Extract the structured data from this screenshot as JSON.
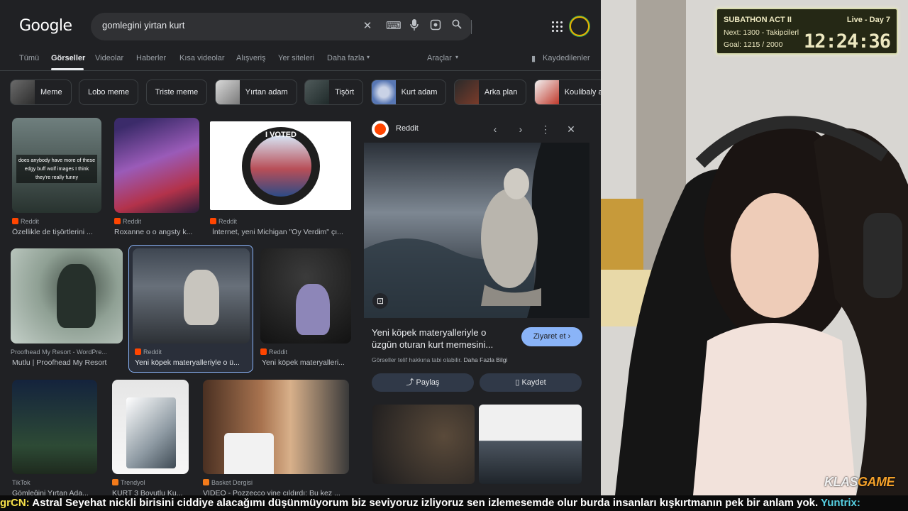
{
  "search": {
    "logo": "Google",
    "query": "gomlegini yirtan kurt"
  },
  "tabs": {
    "items": [
      "Tümü",
      "Görseller",
      "Videolar",
      "Haberler",
      "Kısa videolar",
      "Alışveriş",
      "Yer siteleri",
      "Daha fazla"
    ],
    "tools": "Araçlar",
    "saved": "Kaydedilenler"
  },
  "chips": [
    "Meme",
    "Lobo meme",
    "Triste meme",
    "Yırtan adam",
    "Tişört",
    "Kurt adam",
    "Arka plan",
    "Koulibaly asi"
  ],
  "results": [
    {
      "source": "Reddit",
      "title": "Özellikle de tişörtlerini ...",
      "caption": "does anybody have more of these edgy buff wolf images I think they're really funny"
    },
    {
      "source": "Reddit",
      "title": "Roxanne o o angsty k..."
    },
    {
      "source": "Reddit",
      "title": "İnternet, yeni Michigan \"Oy Verdim\" çı...",
      "caption": "I VOTED"
    },
    {
      "source": "Proofhead My Resort - WordPre...",
      "title": "Mutlu | Proofhead My Resort"
    },
    {
      "source": "Reddit",
      "title": "Yeni köpek materyalleriyle o ü..."
    },
    {
      "source": "Reddit",
      "title": "Yeni köpek materyalleri..."
    },
    {
      "source": "TikTok",
      "title": "Gömleğini Yırtan Ada..."
    },
    {
      "source": "Trendyol",
      "title": "KURT 3 Boyutlu Ku..."
    },
    {
      "source": "Basket Dergisi",
      "title": "VIDEO - Pozzecco yine çıldırdı: Bu kez ..."
    }
  ],
  "panel": {
    "site": "Reddit",
    "title": "Yeni köpek materyalleriyle o üzgün oturan kurt memesini...",
    "visit": "Ziyaret et",
    "copyright": "Görseller telif hakkına tabi olabilir.",
    "more_info": "Daha Fazla Bilgi",
    "share": "Paylaş",
    "save": "Kaydet"
  },
  "overlay": {
    "title": "SUBATHON ACT II",
    "live": "Live - Day 7",
    "next": "Next: 1300 - Takipcilerl",
    "goal": "Goal: 1215 / 2000",
    "timer": "12:24:36"
  },
  "brand": {
    "a": "KLAS",
    "b": "GAME"
  },
  "ticker": {
    "user": "grCN:",
    "message": " Astral Seyehat nickli birisini ciddiye alacağımı düşünmüyorum biz seviyoruz izliyoruz sen izlemesemde olur burda insanları kışkırtmanın pek bir anlam yok.",
    "user2": " Yuntrix:"
  },
  "colors": {
    "accent": "#8ab4f8",
    "reddit": "#ff4500",
    "overlay_bg": "#252815",
    "ticker_user": "#f7e14a"
  }
}
